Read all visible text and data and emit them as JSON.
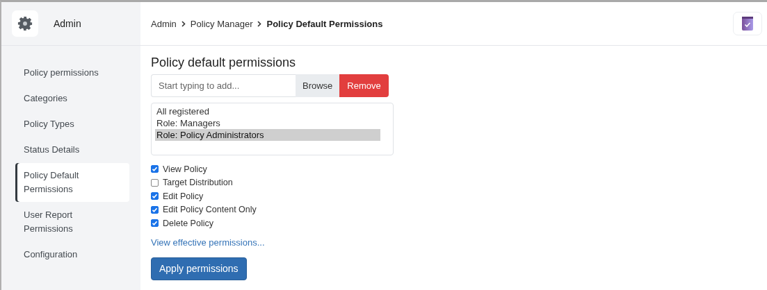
{
  "sidebar": {
    "title": "Admin",
    "items": [
      {
        "label": "Policy permissions",
        "selected": false
      },
      {
        "label": "Categories",
        "selected": false
      },
      {
        "label": "Policy Types",
        "selected": false
      },
      {
        "label": "Status Details",
        "selected": false
      },
      {
        "label": "Policy Default Permissions",
        "selected": true
      },
      {
        "label": "User Report Permissions",
        "selected": false
      },
      {
        "label": "Configuration",
        "selected": false
      }
    ]
  },
  "breadcrumb": [
    {
      "label": "Admin",
      "current": false
    },
    {
      "label": "Policy Manager",
      "current": false
    },
    {
      "label": "Policy Default Permissions",
      "current": true
    }
  ],
  "heading": "Policy default permissions",
  "search": {
    "placeholder": "Start typing to add..."
  },
  "buttons": {
    "browse": "Browse",
    "remove": "Remove",
    "apply": "Apply permissions"
  },
  "principals": [
    {
      "label": "All registered",
      "selected": false
    },
    {
      "label": "Role: Managers",
      "selected": false
    },
    {
      "label": "Role: Policy Administrators",
      "selected": true
    }
  ],
  "permissions": [
    {
      "label": "View Policy",
      "checked": true
    },
    {
      "label": "Target Distribution",
      "checked": false
    },
    {
      "label": "Edit Policy",
      "checked": true
    },
    {
      "label": "Edit Policy Content Only",
      "checked": true
    },
    {
      "label": "Delete Policy",
      "checked": true
    }
  ],
  "link": "View effective permissions..."
}
